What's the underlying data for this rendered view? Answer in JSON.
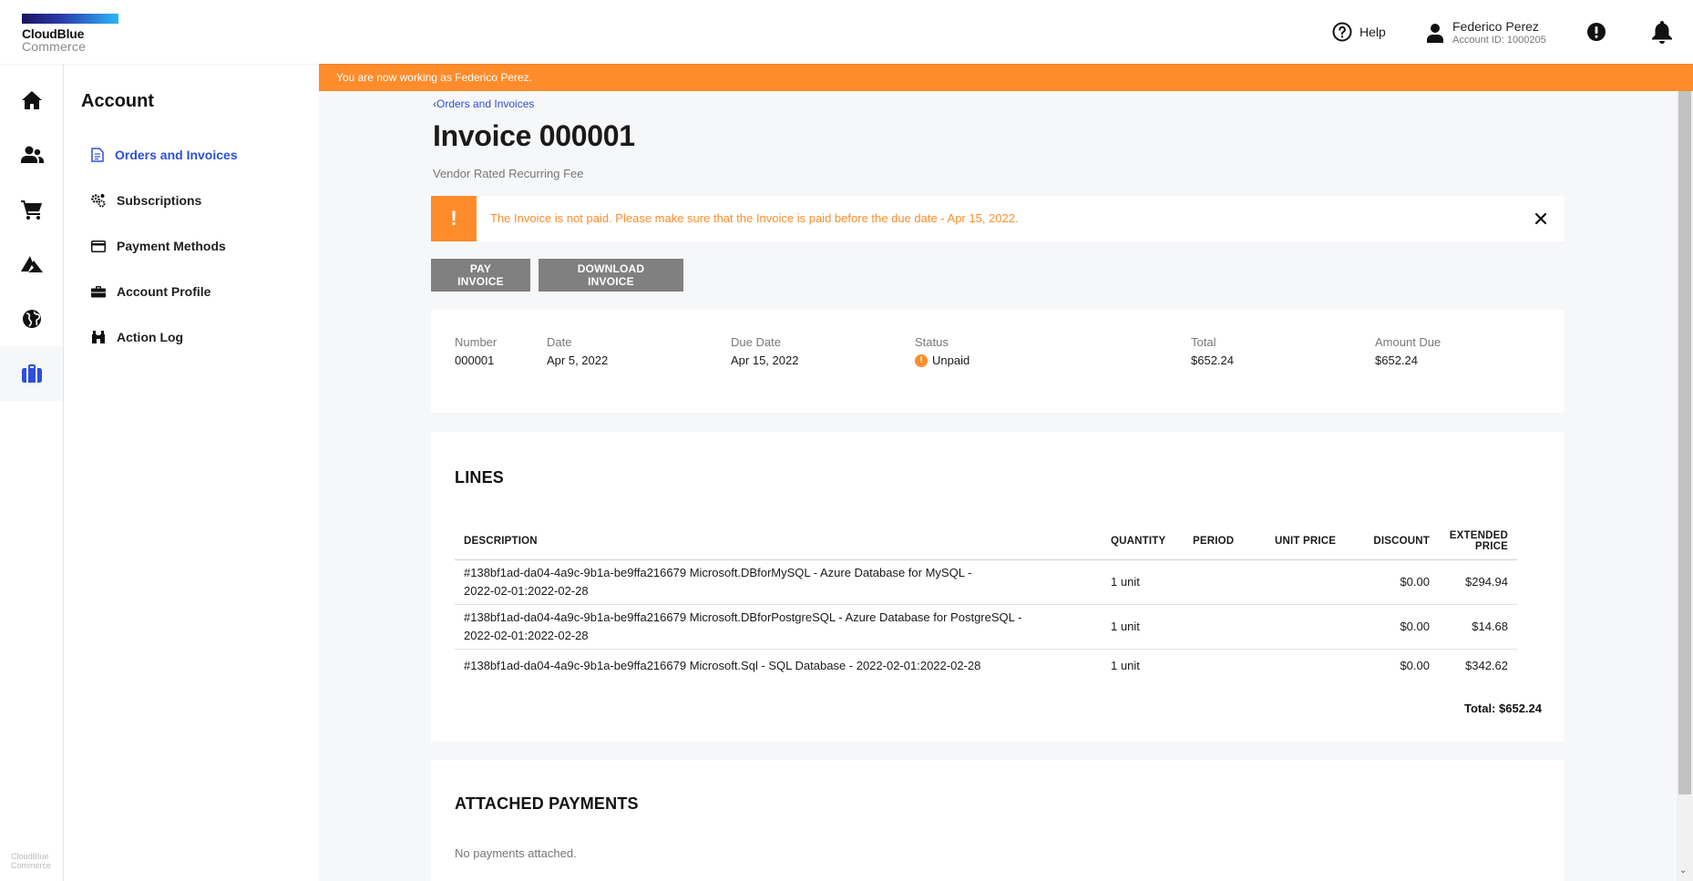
{
  "brand": {
    "line1": "CloudBlue",
    "line2": "Commerce"
  },
  "header": {
    "help_label": "Help",
    "user_name": "Federico Perez",
    "account_id": "Account ID: 1000205"
  },
  "rail": {
    "items": [
      "home-icon",
      "users-icon",
      "cart-icon",
      "cloud-provider-icon",
      "globe-icon",
      "briefcase-icon"
    ],
    "active_index": 5,
    "footer_line1": "CloudBlue",
    "footer_line2": "Commerce"
  },
  "sidebar": {
    "title": "Account",
    "items": [
      {
        "label": "Orders and Invoices",
        "icon": "document-icon",
        "active": true
      },
      {
        "label": "Subscriptions",
        "icon": "gears-icon",
        "active": false
      },
      {
        "label": "Payment Methods",
        "icon": "credit-card-icon",
        "active": false
      },
      {
        "label": "Account Profile",
        "icon": "briefcase-icon",
        "active": false
      },
      {
        "label": "Action Log",
        "icon": "binoculars-icon",
        "active": false
      }
    ]
  },
  "banner": {
    "text": "You are now working as Federico Perez."
  },
  "breadcrumb": {
    "label": "Orders and Invoices"
  },
  "page": {
    "title": "Invoice 000001",
    "subtitle": "Vendor Rated Recurring Fee"
  },
  "alert": {
    "badge": "!",
    "message": "The Invoice is not paid. Please make sure that the Invoice is paid before the due date - Apr 15, 2022."
  },
  "actions": {
    "pay": "PAY INVOICE",
    "download": "DOWNLOAD INVOICE"
  },
  "summary": {
    "number_label": "Number",
    "number": "000001",
    "date_label": "Date",
    "date": "Apr 5, 2022",
    "due_label": "Due Date",
    "due": "Apr 15, 2022",
    "status_label": "Status",
    "status": "Unpaid",
    "total_label": "Total",
    "total": "$652.24",
    "amount_due_label": "Amount Due",
    "amount_due": "$652.24"
  },
  "lines": {
    "title": "LINES",
    "columns": {
      "description": "DESCRIPTION",
      "quantity": "QUANTITY",
      "period": "PERIOD",
      "unit_price": "UNIT PRICE",
      "discount": "DISCOUNT",
      "extended_price_1": "EXTENDED",
      "extended_price_2": "PRICE"
    },
    "rows": [
      {
        "desc1": "#138bf1ad-da04-4a9c-9b1a-be9ffa216679 Microsoft.DBforMySQL - Azure Database for MySQL -",
        "desc2": "2022-02-01:2022-02-28",
        "quantity": "1 unit",
        "period": "",
        "unit_price": "",
        "discount": "$0.00",
        "extended": "$294.94"
      },
      {
        "desc1": "#138bf1ad-da04-4a9c-9b1a-be9ffa216679 Microsoft.DBforPostgreSQL - Azure Database for PostgreSQL -",
        "desc2": "2022-02-01:2022-02-28",
        "quantity": "1 unit",
        "period": "",
        "unit_price": "",
        "discount": "$0.00",
        "extended": "$14.68"
      },
      {
        "desc1": "#138bf1ad-da04-4a9c-9b1a-be9ffa216679 Microsoft.Sql - SQL Database - 2022-02-01:2022-02-28",
        "desc2": "",
        "quantity": "1 unit",
        "period": "",
        "unit_price": "",
        "discount": "$0.00",
        "extended": "$342.62"
      }
    ],
    "total": "Total: $652.24"
  },
  "payments": {
    "title": "ATTACHED PAYMENTS",
    "empty": "No payments attached."
  },
  "colors": {
    "accent": "#ff8c2b",
    "link": "#2e4fd8",
    "button": "#808080"
  }
}
